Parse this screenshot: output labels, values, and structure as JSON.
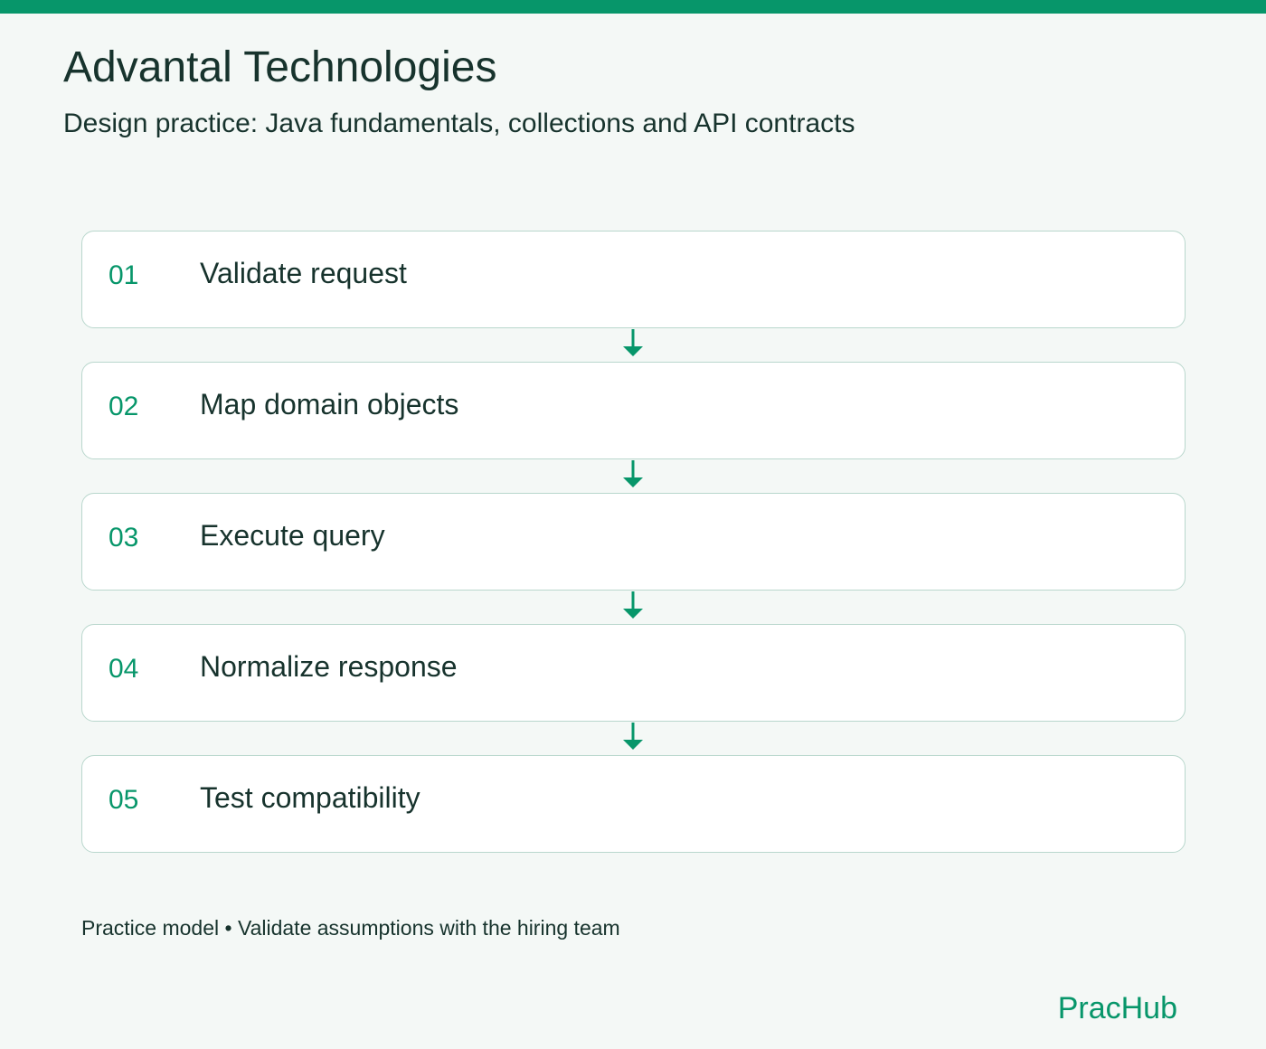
{
  "header": {
    "title": "Advantal Technologies",
    "subtitle": "Design practice: Java fundamentals, collections and API contracts"
  },
  "steps": [
    {
      "number": "01",
      "label": "Validate request"
    },
    {
      "number": "02",
      "label": "Map domain objects"
    },
    {
      "number": "03",
      "label": "Execute query"
    },
    {
      "number": "04",
      "label": "Normalize response"
    },
    {
      "number": "05",
      "label": "Test compatibility"
    }
  ],
  "footer": {
    "note": "Practice model • Validate assumptions with the hiring team",
    "brand": "PracHub"
  },
  "colors": {
    "accent": "#07966a",
    "text": "#17332d",
    "background": "#f4f8f6",
    "card_border": "#b9d7cd"
  },
  "icons": {
    "connector": "arrow-down-icon"
  }
}
